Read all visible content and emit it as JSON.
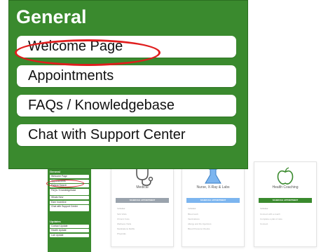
{
  "zoom": {
    "heading": "General",
    "items": [
      {
        "label": "Welcome Page"
      },
      {
        "label": "Appointments"
      },
      {
        "label": "FAQs / Knowledgebase"
      },
      {
        "label": "Chat with Support Center"
      }
    ],
    "highlight_color": "#e01d1d"
  },
  "sidebar": {
    "heading": "General",
    "items": [
      {
        "label": "Welcome Page"
      },
      {
        "label": "Appointments"
      },
      {
        "label": "Patient Search"
      },
      {
        "label": "FAQs / Knowledgebase"
      },
      {
        "label": "Whats New"
      },
      {
        "label": "Earn Incentive"
      },
      {
        "label": "Chat with Support Center"
      }
    ],
    "update_heading": "Updates",
    "update_items": [
      {
        "label": "Contact Update"
      },
      {
        "label": "Health Update"
      },
      {
        "label": "Lab Update"
      }
    ]
  },
  "cards": [
    {
      "title": "Medical",
      "icon": "stethoscope-icon",
      "button": "SCHEDULE APPOINTMENT",
      "button_color": "#9aa3ad",
      "includes": "Includes:",
      "items": [
        "Sick Visits",
        "Chronic Care",
        "Wellness Visits",
        "Medications Refills",
        "Physicals"
      ]
    },
    {
      "title": "Nurse, X-Ray & Labs",
      "icon": "flask-icon",
      "button": "SCHEDULE APPOINTMENT",
      "button_color": "#7cb5ef",
      "includes": "Includes:",
      "items": [
        "Blood work",
        "Vaccinations",
        "Allergy and Flu Injections",
        "Blood Pressure Checks"
      ]
    },
    {
      "title": "Health Coaching",
      "icon": "apple-icon",
      "button": "SCHEDULE APPOINTMENT",
      "button_color": "#3a8a2e",
      "includes": "Includes:",
      "items": [
        "Connect with a coach",
        "Complete a plan of care",
        "Connect"
      ]
    }
  ],
  "colors": {
    "brand_green": "#3a8a2e",
    "highlight_red": "#e01d1d"
  }
}
